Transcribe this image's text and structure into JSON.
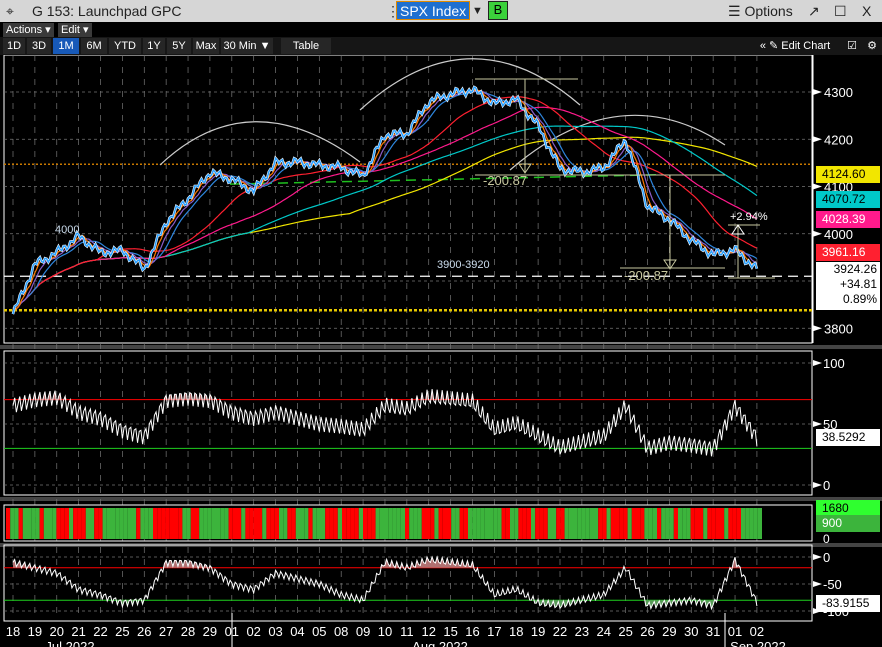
{
  "window": {
    "title": "G 153: Launchpad GPC",
    "ticker": "SPX Index",
    "b_button": "B",
    "options": "Options",
    "popout": "↗",
    "maximize": "☐",
    "close": "X",
    "menu_icon": "crosshair-icon"
  },
  "menu": {
    "actions": "Actions ▾",
    "edit": "Edit ▾"
  },
  "tabs": [
    {
      "label": "1D"
    },
    {
      "label": "3D"
    },
    {
      "label": "1M",
      "active": true
    },
    {
      "label": "6M"
    },
    {
      "label": "YTD"
    },
    {
      "label": "1Y"
    },
    {
      "label": "5Y"
    },
    {
      "label": "Max"
    },
    {
      "label": "30 Min ▼"
    },
    {
      "label": "Table"
    }
  ],
  "toolbar": {
    "collapse": "«",
    "edit_chart": "Edit Chart"
  },
  "colors": {
    "price": "#2aa0ff",
    "ma1": "#ff7a00",
    "ma2": "#8a5cc8",
    "ma3": "#2e86de",
    "ma4": "#ff2030",
    "ma5": "#ff1a8c",
    "ma6": "#00c8c8",
    "ma7": "#f2e600",
    "rsi": "#ffffff",
    "up": "#3cb43c",
    "down": "#ff0000"
  },
  "chart_data": [
    {
      "type": "line",
      "title": "SPX Index",
      "ylim": [
        3760,
        4340
      ],
      "x": [
        "18",
        "19",
        "20",
        "21",
        "22",
        "25",
        "26",
        "27",
        "28",
        "29",
        "01",
        "02",
        "03",
        "04",
        "05",
        "08",
        "09",
        "10",
        "11",
        "12",
        "15",
        "16",
        "17",
        "18",
        "19",
        "22",
        "23",
        "24",
        "25",
        "26",
        "29",
        "30",
        "31",
        "01",
        "02"
      ],
      "months": [
        "Jul 2022",
        "Aug 2022",
        "Sep 2022"
      ],
      "yticks": [
        3800,
        3900,
        4000,
        4100,
        4200,
        4300
      ],
      "ytick_labels": [
        "3800",
        "4000",
        "4100",
        "4200",
        "4300"
      ],
      "series": [
        {
          "values": [
            3830,
            3935,
            3960,
            3995,
            3960,
            3965,
            3925,
            4025,
            4075,
            4130,
            4115,
            4090,
            4150,
            4152,
            4145,
            4140,
            4122,
            4210,
            4212,
            4280,
            4296,
            4305,
            4275,
            4284,
            4228,
            4137,
            4130,
            4140,
            4199,
            4058,
            4030,
            3986,
            3955,
            3966,
            3924.26
          ]
        }
      ],
      "last_values": [
        {
          "value": "4124.60",
          "color": "#f2e600"
        },
        {
          "value": "4070.72",
          "color": "#00c8c8"
        },
        {
          "value": "4028.39",
          "color": "#ff1a8c"
        },
        {
          "value": "3961.16",
          "color": "#ff2030"
        }
      ],
      "last_price": "3924.26",
      "change": "+34.81",
      "change_pct": "0.89%",
      "annotations": {
        "level_4000": "4000",
        "zone": "3900-3920",
        "drop1": "-200.87",
        "drop2": "-200.87",
        "bounce": "+2.94%"
      },
      "hlines": [
        3910,
        3880,
        4147,
        4085
      ]
    },
    {
      "type": "line",
      "ylim": [
        0,
        100
      ],
      "yticks": [
        "0",
        "50",
        "100"
      ],
      "overbought": 70,
      "oversold": 30,
      "last": "38.5292",
      "values": [
        65,
        70,
        72,
        60,
        55,
        45,
        40,
        70,
        72,
        70,
        60,
        55,
        60,
        55,
        50,
        48,
        45,
        65,
        62,
        72,
        70,
        68,
        45,
        50,
        40,
        30,
        35,
        40,
        65,
        30,
        35,
        33,
        30,
        65,
        38.53
      ]
    },
    {
      "type": "bar",
      "yticks": [
        "0",
        "1680",
        "900"
      ],
      "labels": [
        "1680",
        "900"
      ]
    },
    {
      "type": "line",
      "ylim": [
        -100,
        0
      ],
      "yticks": [
        "0",
        "-50",
        "-100"
      ],
      "upper": -20,
      "lower": -80,
      "last": "-83.9155",
      "values": [
        -10,
        -20,
        -30,
        -60,
        -70,
        -85,
        -80,
        -10,
        -10,
        -20,
        -50,
        -60,
        -30,
        -40,
        -50,
        -70,
        -80,
        -10,
        -20,
        -5,
        -10,
        -15,
        -70,
        -60,
        -85,
        -90,
        -80,
        -70,
        -20,
        -90,
        -85,
        -80,
        -90,
        -5,
        -83.92
      ]
    }
  ]
}
